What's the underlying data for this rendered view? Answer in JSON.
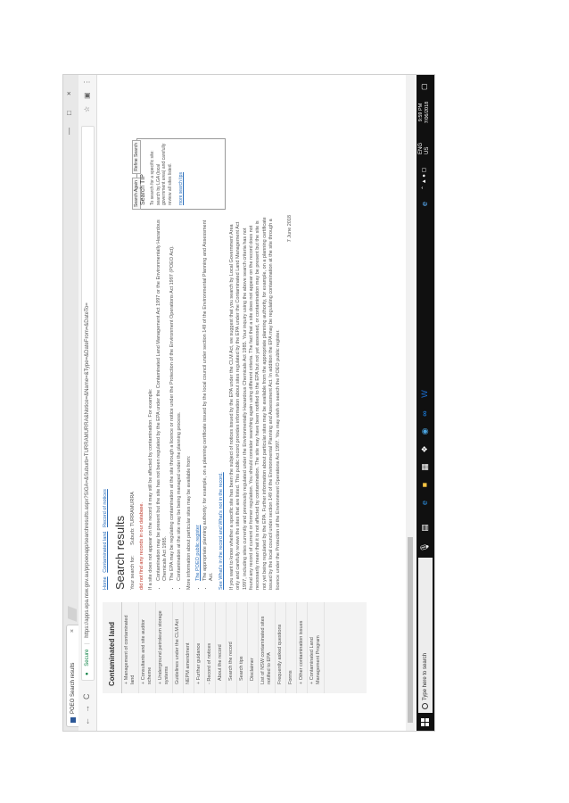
{
  "browser": {
    "tab_title": "POEO Search results",
    "tab_close": "×",
    "window_controls": [
      "—",
      "□",
      "×"
    ],
    "nav": {
      "back": "←",
      "forward": "→",
      "reload": "C"
    },
    "secure_label": "Secure",
    "url": "https://apps.epa.nsw.gov.au/prpoeoapp/searchresults.aspx?SiGA=&Suburb=TURRAMURRA&Notice=&Name=&Type=&DateFrom=&DateTo="
  },
  "sidebar": {
    "title": "Contaminated land",
    "items": [
      "+ Management of contaminated land",
      "+ Consultants and site auditor scheme",
      "+ Underground petroleum storage systems",
      "Guidelines under the CLM Act",
      "NEPM amendment",
      "+ Further guidance",
      "- Record of notices",
      "About the record",
      "Search the record",
      "Search tips",
      "Disclaimer",
      "List of NSW contaminated sites notified to EPA",
      "Frequently asked questions",
      "Forms",
      "+ Other contamination issues",
      "+ Contaminated Land Management Program"
    ]
  },
  "main": {
    "breadcrumb": [
      "Home",
      "Contaminated land",
      "Record of notices"
    ],
    "title": "Search results",
    "search_for_label": "Your search for:",
    "search_for_value": "Suburb: TURRAMURRA",
    "no_records": "did not find any records in our database.",
    "intro": "If a site does not appear on the record it may still be affected by contamination. For example:",
    "bullets1": [
      "Contamination may be present but the site has not been regulated by the EPA under the Contaminated Land Management Act 1997 or the Environmentally Hazardous Chemicals Act 1985.",
      "The EPA may be regulating contamination at the site through a licence or notice under the Protection of the Environment Operations Act 1997 (POEO Act).",
      "Contamination at the site may be being managed under the planning process."
    ],
    "bullet1_link": "planning process",
    "more_info": "More information about particular sites may be available from:",
    "bullets2": [
      "The POEO public register",
      "The appropriate planning authority: for example, on a planning certificate issued by the local council under section 149 of the Environmental Planning and Assessment Act."
    ],
    "see_link": "See What's in the record and What's not in the record.",
    "para": "If you want to know whether a specific site has been the subject of notices issued by the EPA under the CLM Act, we suggest that you search by Local Government Area only and carefully review the sites that are listed. This public record provides information about sites regulated by the EPA under the Contaminated Land Management Act 1997, including sites currently and previously regulated under the Environmentally Hazardous Chemicals Act 1985. Your inquiry using the above search criteria has not found any record of current or former regulation. You should consider searching again using different criteria. The fact that a site does not appear on the record does not necessarily mean that it is not affected by contamination. The site may have been notified to the EPA but not yet assessed, or contamination may be present but the site is not yet being regulated by the EPA. Further information about particular sites may be available from the appropriate planning authority, for example, on a planning certificate issued by the local council under section 149 of the Environmental Planning and Assessment Act. In addition the EPA may be regulating contamination at the site through a licence under the Protection of the Environment Operations Act 1997. You may wish to search the POEO public register.",
    "para_link": "POEO public register",
    "date": "7 June 2018"
  },
  "tipbox": {
    "btn_search_again": "Search Again",
    "btn_refine": "Refine Search",
    "title": "Search TIP",
    "text": "To search for a specific site: search by LGA (local government area) and carefully review all sites listed.",
    "link": "more search tips"
  },
  "taskbar": {
    "search_placeholder": "Type here to search",
    "tray_lang": "ENG",
    "tray_region": "US",
    "time": "9:59 PM",
    "date": "7/06/2018"
  }
}
